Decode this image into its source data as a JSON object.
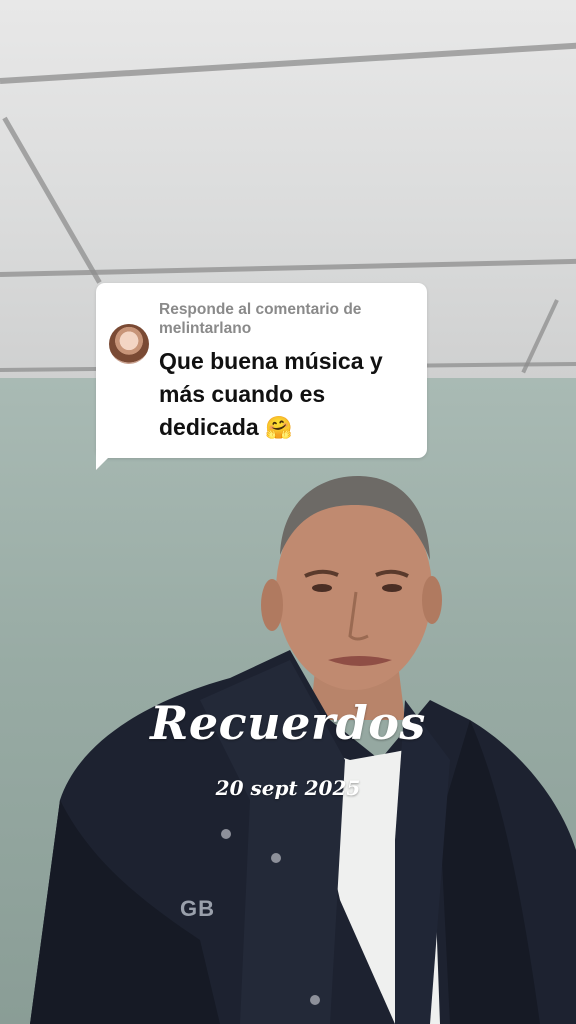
{
  "comment_reply": {
    "header": "Responde al comentario de melintarlano",
    "text": "Que buena música y más cuando es dedicada",
    "emoji": "🤗"
  },
  "overlay": {
    "title": "Recuerdos",
    "date": "20 sept 2025"
  },
  "jacket_logo": "GB"
}
